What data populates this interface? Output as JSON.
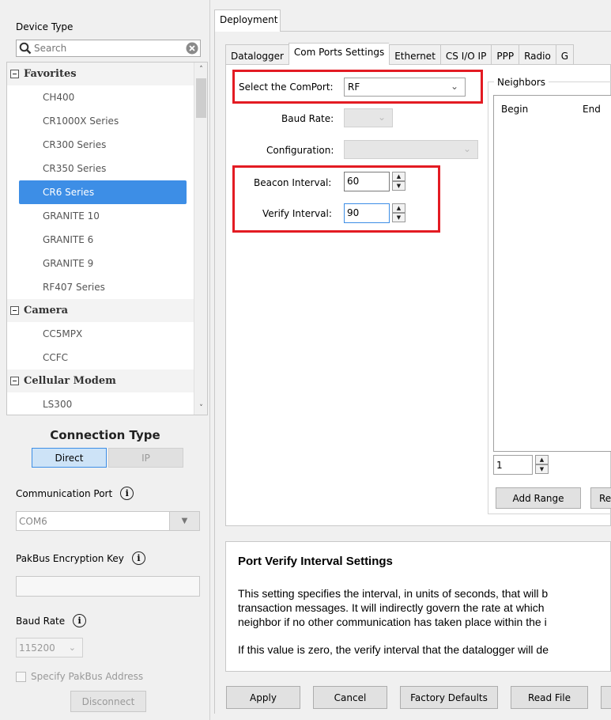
{
  "left": {
    "device_type_label": "Device Type",
    "search_placeholder": "Search",
    "tree": [
      {
        "group": "Favorites",
        "items": [
          "CH400",
          "CR1000X Series",
          "CR300 Series",
          "CR350 Series",
          "CR6 Series",
          "GRANITE 10",
          "GRANITE 6",
          "GRANITE 9",
          "RF407 Series"
        ]
      },
      {
        "group": "Camera",
        "items": [
          "CC5MPX",
          "CCFC"
        ]
      },
      {
        "group": "Cellular Modem",
        "items": [
          "LS300"
        ]
      }
    ],
    "selected_item": "CR6 Series",
    "connection_type_title": "Connection Type",
    "connection_direct": "Direct",
    "connection_ip": "IP",
    "comm_port_label": "Communication Port",
    "comm_port_value": "COM6",
    "encryption_label": "PakBus Encryption Key",
    "encryption_value": "",
    "baud_label": "Baud Rate",
    "baud_value": "115200",
    "specify_pakbus_label": "Specify PakBus Address",
    "disconnect_label": "Disconnect"
  },
  "main": {
    "deployment_tab": "Deployment",
    "tabs": [
      "Datalogger",
      "Com Ports Settings",
      "Ethernet",
      "CS I/O IP",
      "PPP",
      "Radio",
      "G"
    ],
    "active_tab": "Com Ports Settings",
    "select_comport_label": "Select the ComPort:",
    "select_comport_value": "RF",
    "baud_rate_label": "Baud Rate:",
    "configuration_label": "Configuration:",
    "beacon_label": "Beacon Interval:",
    "beacon_value": "60",
    "verify_label": "Verify Interval:",
    "verify_value": "90",
    "neighbors": {
      "title": "Neighbors",
      "col_begin": "Begin",
      "col_end": "End",
      "spin_value": "1",
      "add_range": "Add Range",
      "remove_partial": "Re"
    },
    "help": {
      "title": "Port Verify Interval Settings",
      "line1": "This setting specifies the interval, in units of seconds, that will b",
      "line2": "transaction messages. It will indirectly govern the rate at which",
      "line3": "neighbor if no other communication has taken place within the i",
      "line4": "If this value is zero, the verify interval that the datalogger will de"
    },
    "buttons": {
      "apply": "Apply",
      "cancel": "Cancel",
      "factory_defaults": "Factory Defaults",
      "read_file": "Read File"
    }
  },
  "colors": {
    "selection": "#3d8ee6",
    "highlight_box": "#e31b23"
  }
}
